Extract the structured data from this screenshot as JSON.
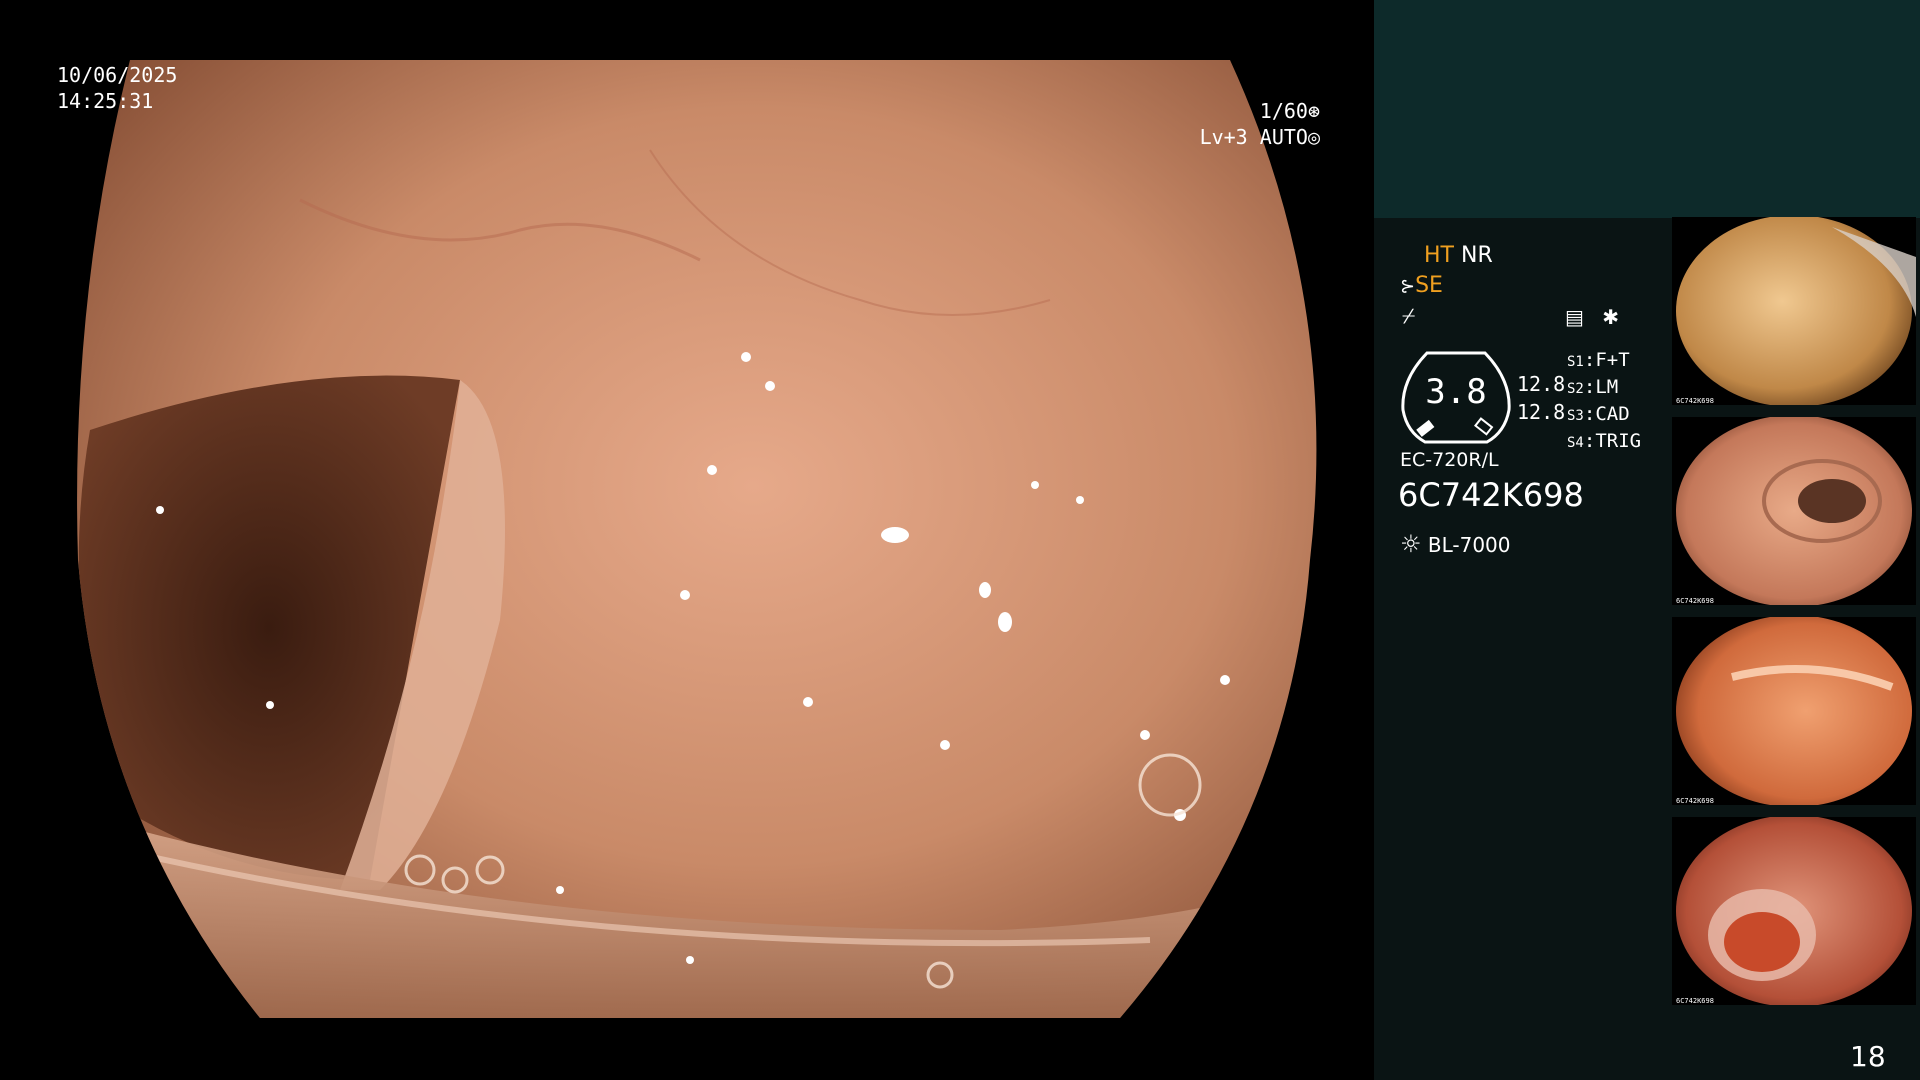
{
  "overlay": {
    "date": "10/06/2025",
    "time": "14:25:31",
    "shutter": "1/60",
    "level": "Lv+3",
    "mode": "AUTO"
  },
  "settings": {
    "ht": "HT",
    "nr": "NR",
    "se": "SE",
    "value_main": "3.8",
    "value_top": "12.8",
    "value_bottom": "12.8",
    "s1_key": "S1",
    "s1_val": "F+T",
    "s2_key": "S2",
    "s2_val": "LM",
    "s3_key": "S3",
    "s3_val": "CAD",
    "s4_key": "S4",
    "s4_val": "TRIG",
    "scope_model": "EC-720R/L",
    "serial": "6C742K698",
    "light_source": "BL-7000"
  },
  "thumbnails": [
    {
      "id": "1",
      "serial": "6C742K698"
    },
    {
      "id": "2",
      "serial": "6C742K698"
    },
    {
      "id": "3",
      "serial": "6C742K698"
    },
    {
      "id": "4",
      "serial": "6C742K698"
    }
  ],
  "page_number": "18",
  "colors": {
    "panel_top": "#0d2a2a",
    "panel": "#0a1414",
    "accent_orange": "#f0a020",
    "mucosa": "#c98a68"
  }
}
